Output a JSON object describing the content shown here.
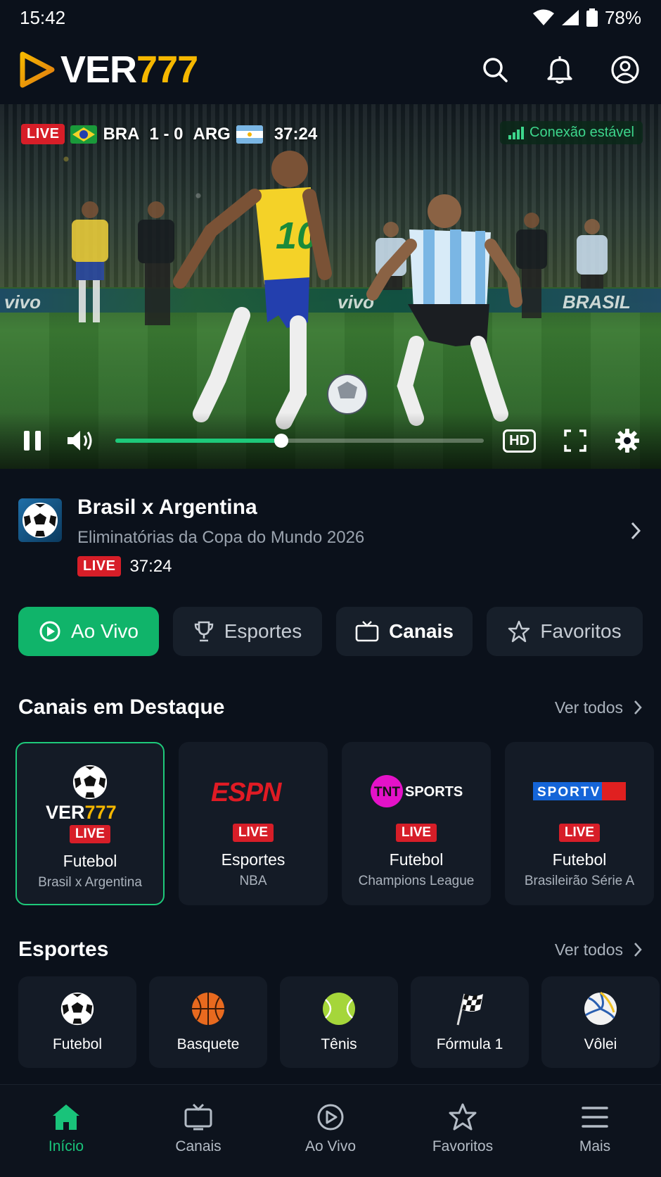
{
  "status_bar": {
    "time": "15:42",
    "battery": "78%"
  },
  "header": {
    "logo_main": "VER",
    "logo_accent": "777"
  },
  "player": {
    "live_label": "LIVE",
    "home": "BRA",
    "score": "1 - 0",
    "away": "ARG",
    "clock": "37:24",
    "connection": "Conexão estável",
    "quality": "HD",
    "progress": 0.45,
    "ad_texts": [
      "vivo",
      "vivo",
      "BRASIL"
    ]
  },
  "match": {
    "title": "Brasil x Argentina",
    "subtitle": "Eliminatórias da Copa do Mundo 2026",
    "live_label": "LIVE",
    "time": "37:24"
  },
  "tabs": [
    {
      "label": "Ao Vivo",
      "icon": "play-circle-icon"
    },
    {
      "label": "Esportes",
      "icon": "trophy-icon"
    },
    {
      "label": "Canais",
      "icon": "tv-icon"
    },
    {
      "label": "Favoritos",
      "icon": "star-icon"
    }
  ],
  "featured": {
    "title": "Canais em Destaque",
    "see_all": "Ver todos",
    "channels": [
      {
        "logo": "VER777",
        "live": "LIVE",
        "name": "Futebol",
        "sub": "Brasil x Argentina"
      },
      {
        "logo": "ESPN",
        "live": "LIVE",
        "name": "Esportes",
        "sub": "NBA"
      },
      {
        "logo": "TNT SPORTS",
        "live": "LIVE",
        "name": "Futebol",
        "sub": "Champions League"
      },
      {
        "logo": "SPORTV",
        "live": "LIVE",
        "name": "Futebol",
        "sub": "Brasileirão Série A"
      }
    ]
  },
  "sports": {
    "title": "Esportes",
    "see_all": "Ver todos",
    "items": [
      {
        "label": "Futebol",
        "icon": "soccer-ball-icon"
      },
      {
        "label": "Basquete",
        "icon": "basketball-icon"
      },
      {
        "label": "Tênis",
        "icon": "tennis-ball-icon"
      },
      {
        "label": "Fórmula 1",
        "icon": "checkered-flag-icon"
      },
      {
        "label": "Vôlei",
        "icon": "volleyball-icon"
      }
    ]
  },
  "bottom_nav": [
    {
      "label": "Início",
      "icon": "home-icon"
    },
    {
      "label": "Canais",
      "icon": "tv-icon"
    },
    {
      "label": "Ao Vivo",
      "icon": "play-circle-icon"
    },
    {
      "label": "Favoritos",
      "icon": "star-icon"
    },
    {
      "label": "Mais",
      "icon": "menu-icon"
    }
  ],
  "colors": {
    "accent": "#10b46a",
    "live": "#d71e28",
    "logo_accent": "#f5b700",
    "background": "#0b111b"
  }
}
